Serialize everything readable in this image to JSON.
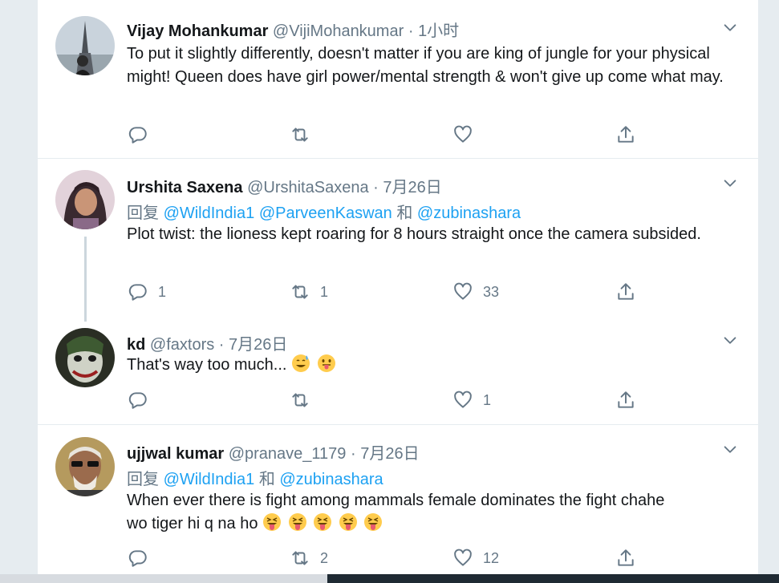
{
  "colors": {
    "accent": "#1da1f2",
    "muted": "#657786",
    "text": "#14171a"
  },
  "tweets": [
    {
      "name": "Vijay Mohankumar",
      "handle": "@VijiMohankumar",
      "dot": "·",
      "time": "1小时",
      "text": "To put it slightly differently, doesn't matter if you are king of jungle for your physical might! Queen does have girl power/mental strength & won't give up come what may.",
      "reply_count": "",
      "retweet_count": "",
      "like_count": ""
    },
    {
      "name": "Urshita Saxena",
      "handle": "@UrshitaSaxena",
      "dot": "·",
      "time": "7月26日",
      "reply_prefix": "回复",
      "mention1": "@WildIndia1",
      "mention2": "@ParveenKaswan",
      "conj": "和",
      "mention3": "@zubinashara",
      "text": "Plot twist: the lioness kept roaring for 8 hours straight once the camera subsided.",
      "reply_count": "1",
      "retweet_count": "1",
      "like_count": "33"
    },
    {
      "name": "kd",
      "handle": "@faxtors",
      "dot": "·",
      "time": "7月26日",
      "text": "That's way too much...",
      "reply_count": "",
      "retweet_count": "",
      "like_count": "1"
    },
    {
      "name": "ujjwal kumar",
      "handle": "@pranave_1179",
      "dot": "·",
      "time": "7月26日",
      "reply_prefix": "回复",
      "mention1": "@WildIndia1",
      "conj": "和",
      "mention2": "@zubinashara",
      "text_line1": "When ever there is fight among mammals  female dominates the fight chahe",
      "text_line2": "wo tiger hi q na ho",
      "reply_count": "",
      "retweet_count": "2",
      "like_count": "12"
    }
  ],
  "icons": [
    "reply-icon",
    "retweet-icon",
    "like-icon",
    "share-icon",
    "chevron-down-icon",
    "sweat-smile-emoji",
    "tongue-emoji",
    "squint-tongue-emoji"
  ]
}
